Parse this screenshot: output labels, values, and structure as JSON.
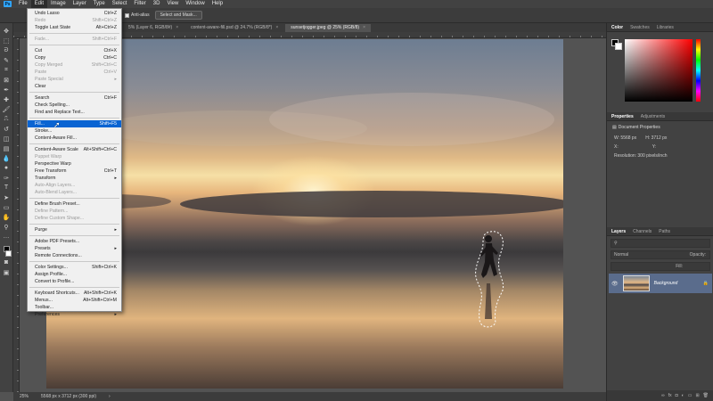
{
  "menubar": {
    "items": [
      "File",
      "Edit",
      "Image",
      "Layer",
      "Type",
      "Select",
      "Filter",
      "3D",
      "View",
      "Window",
      "Help"
    ],
    "active": "Edit"
  },
  "options_bar": {
    "antialias_label": "Anti-alias",
    "select_mask_label": "Select and Mask..."
  },
  "tabs": [
    {
      "label": "5% (Layer 6, RGB/8#)",
      "active": false
    },
    {
      "label": "content-aware-fill.psd @ 24.7% (RGB/8*)",
      "active": false
    },
    {
      "label": "sunsetjogger.jpeg @ 25% (RGB/8)",
      "active": true
    }
  ],
  "edit_menu": [
    {
      "label": "Undo Lasso",
      "shortcut": "Ctrl+Z",
      "enabled": true
    },
    {
      "label": "Redo",
      "shortcut": "Shift+Ctrl+Z",
      "enabled": false
    },
    {
      "label": "Toggle Last State",
      "shortcut": "Alt+Ctrl+Z",
      "enabled": true
    },
    {
      "sep": true
    },
    {
      "label": "Fade...",
      "shortcut": "Shift+Ctrl+F",
      "enabled": false
    },
    {
      "sep": true
    },
    {
      "label": "Cut",
      "shortcut": "Ctrl+X",
      "enabled": true
    },
    {
      "label": "Copy",
      "shortcut": "Ctrl+C",
      "enabled": true
    },
    {
      "label": "Copy Merged",
      "shortcut": "Shift+Ctrl+C",
      "enabled": false
    },
    {
      "label": "Paste",
      "shortcut": "Ctrl+V",
      "enabled": false
    },
    {
      "label": "Paste Special",
      "shortcut": "",
      "enabled": false,
      "submenu": true
    },
    {
      "label": "Clear",
      "shortcut": "",
      "enabled": true
    },
    {
      "sep": true
    },
    {
      "label": "Search",
      "shortcut": "Ctrl+F",
      "enabled": true
    },
    {
      "label": "Check Spelling...",
      "shortcut": "",
      "enabled": true
    },
    {
      "label": "Find and Replace Text...",
      "shortcut": "",
      "enabled": true
    },
    {
      "sep": true
    },
    {
      "label": "Fill...",
      "shortcut": "Shift+F5",
      "enabled": true,
      "highlighted": true
    },
    {
      "label": "Stroke...",
      "shortcut": "",
      "enabled": true
    },
    {
      "label": "Content-Aware Fill...",
      "shortcut": "",
      "enabled": true
    },
    {
      "sep": true
    },
    {
      "label": "Content-Aware Scale",
      "shortcut": "Alt+Shift+Ctrl+C",
      "enabled": true
    },
    {
      "label": "Puppet Warp",
      "shortcut": "",
      "enabled": false
    },
    {
      "label": "Perspective Warp",
      "shortcut": "",
      "enabled": true
    },
    {
      "label": "Free Transform",
      "shortcut": "Ctrl+T",
      "enabled": true
    },
    {
      "label": "Transform",
      "shortcut": "",
      "enabled": true,
      "submenu": true
    },
    {
      "label": "Auto-Align Layers...",
      "shortcut": "",
      "enabled": false
    },
    {
      "label": "Auto-Blend Layers...",
      "shortcut": "",
      "enabled": false
    },
    {
      "sep": true
    },
    {
      "label": "Define Brush Preset...",
      "shortcut": "",
      "enabled": true
    },
    {
      "label": "Define Pattern...",
      "shortcut": "",
      "enabled": false
    },
    {
      "label": "Define Custom Shape...",
      "shortcut": "",
      "enabled": false
    },
    {
      "sep": true
    },
    {
      "label": "Purge",
      "shortcut": "",
      "enabled": true,
      "submenu": true
    },
    {
      "sep": true
    },
    {
      "label": "Adobe PDF Presets...",
      "shortcut": "",
      "enabled": true
    },
    {
      "label": "Presets",
      "shortcut": "",
      "enabled": true,
      "submenu": true
    },
    {
      "label": "Remote Connections...",
      "shortcut": "",
      "enabled": true
    },
    {
      "sep": true
    },
    {
      "label": "Color Settings...",
      "shortcut": "Shift+Ctrl+K",
      "enabled": true
    },
    {
      "label": "Assign Profile...",
      "shortcut": "",
      "enabled": true
    },
    {
      "label": "Convert to Profile...",
      "shortcut": "",
      "enabled": true
    },
    {
      "sep": true
    },
    {
      "label": "Keyboard Shortcuts...",
      "shortcut": "Alt+Shift+Ctrl+K",
      "enabled": true
    },
    {
      "label": "Menus...",
      "shortcut": "Alt+Shift+Ctrl+M",
      "enabled": true
    },
    {
      "label": "Toolbar...",
      "shortcut": "",
      "enabled": true
    },
    {
      "label": "Preferences",
      "shortcut": "",
      "enabled": true,
      "submenu": true
    }
  ],
  "color_panel": {
    "tabs": [
      "Color",
      "Swatches",
      "Libraries"
    ],
    "active_tab": "Color",
    "hue_color": "#ff0000"
  },
  "properties_panel": {
    "tabs": [
      "Properties",
      "Adjustments"
    ],
    "title": "Document Properties",
    "w_label": "W:",
    "w_value": "5568 px",
    "h_label": "H:",
    "h_value": "3712 px",
    "x_label": "X:",
    "y_label": "Y:",
    "resolution": "Resolution: 300 pixels/inch"
  },
  "layers_panel": {
    "tabs": [
      "Layers",
      "Channels",
      "Paths"
    ],
    "blend_mode": "Normal",
    "opacity_label": "Opacity:",
    "fill_label": "Fill:",
    "layer_name": "Background"
  },
  "status_bar": {
    "zoom": "25%",
    "doc_info": "5568 px x 3712 px (300 ppi)"
  },
  "colors": {
    "highlight": "#0a64d2",
    "selected_layer": "#5a6c8c"
  }
}
